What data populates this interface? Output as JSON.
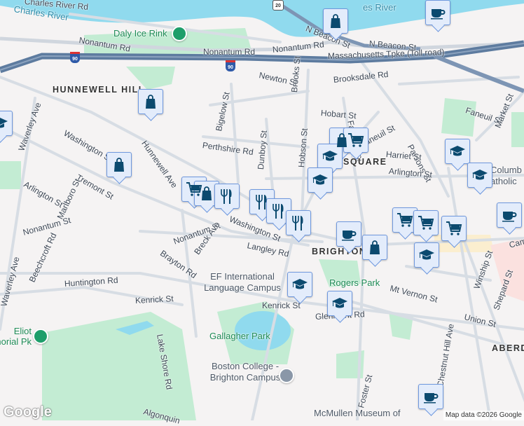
{
  "labels": {
    "charles_river_rd": "Charles River Rd",
    "charles_river": "Charles River",
    "charles_river_2": "es River",
    "daly_ice_rink": "Daly Ice Rink",
    "nonantum_rd_1": "Nonantum Rd",
    "nonantum_rd_2": "Nonantum Rd",
    "nonantum_rd_3": "Nonantum Rd",
    "n_beacon_1": "N Beacon St",
    "n_beacon_2": "N Beacon St",
    "mass_pike": "Massachusetts Tpke (Toll road)",
    "hunnewell_hill": "HUNNEWELL HILL",
    "newton_st": "Newton St",
    "brooks_st": "Brooks St",
    "brooksdale_rd": "Brooksdale Rd",
    "hobart_st": "Hobart St",
    "falkland_st": "Falkland St",
    "faneuil_st_1": "Faneuil St",
    "faneuil_st_2": "Faneuil St",
    "parsons_st": "Parsons St",
    "market_st": "Market St",
    "harriet_st": "Harriet St",
    "square": "SQUARE",
    "arlington_st_1": "Arlington St",
    "arlington_st_2": "Arlington St",
    "washington_st_1": "Washington St",
    "washington_st_2": "Washington St",
    "waverley_ave": "Waverley Ave",
    "tremont_st": "Tremont St",
    "marlboro_st": "Marlboro St",
    "hunnewell_ave": "Hunnewell Ave",
    "perthshire_rd": "Perthshire Rd",
    "bigelow_st": "Bigelow St",
    "dunboy_st": "Dunboy St",
    "hobson_st": "Hobson St",
    "nonantum_st_1": "Nonantum St",
    "nonantum_st_2": "Nonantum St",
    "breck_ave": "Breck Ave",
    "langley_rd": "Langley Rd",
    "brighton": "BRIGHTON",
    "brayton_rd": "Brayton Rd",
    "beechcroft_rd": "Beechcroft Rd",
    "huntington_rd": "Huntington Rd",
    "kenrick_st_1": "Kenrick St",
    "kenrick_st_2": "Kenrick St",
    "ef_campus": "EF International Language Campus",
    "rogers_park": "Rogers Park",
    "mt_vernon_st": "Mt Vernon St",
    "glenmont_rd": "Glenmont Rd",
    "lake_shore_rd": "Lake Shore Rd",
    "gallagher_park": "Gallagher Park",
    "eliot_pk": "Eliot Memorial Pk",
    "bc_campus": "Boston College - Brighton Campus",
    "foster_st": "Foster St",
    "chestnut_hill_ave": "Chestnut Hill Ave",
    "union_st": "Union St",
    "winship_st": "Winship St",
    "shepard_st": "Shepard St",
    "aberdeen": "ABERD",
    "mcmullen": "McMullen Museum of",
    "algonquin": "Algonquin",
    "columbkille": "Columb atholic",
    "cambridge": "Cam"
  },
  "shields": {
    "i90": "90",
    "us20": "20"
  },
  "markers": [
    {
      "type": "shopping-bag"
    },
    {
      "type": "coffee-cup"
    },
    {
      "type": "shopping-bag"
    },
    {
      "type": "shopping-bag"
    },
    {
      "type": "graduation-cap"
    },
    {
      "type": "shopping-cart"
    },
    {
      "type": "shopping-bag"
    },
    {
      "type": "restaurant"
    },
    {
      "type": "restaurant"
    },
    {
      "type": "restaurant"
    },
    {
      "type": "restaurant"
    },
    {
      "type": "shopping-bag"
    },
    {
      "type": "shopping-cart"
    },
    {
      "type": "graduation-cap"
    },
    {
      "type": "graduation-cap"
    },
    {
      "type": "graduation-cap"
    },
    {
      "type": "graduation-cap"
    },
    {
      "type": "coffee-cup"
    },
    {
      "type": "shopping-cart"
    },
    {
      "type": "shopping-cart"
    },
    {
      "type": "shopping-cart"
    },
    {
      "type": "graduation-cap"
    },
    {
      "type": "coffee-cup"
    },
    {
      "type": "shopping-bag"
    },
    {
      "type": "graduation-cap"
    },
    {
      "type": "graduation-cap"
    },
    {
      "type": "coffee-cup"
    }
  ],
  "attribution": "Map data ©2026 Google",
  "logo": "Google",
  "colors": {
    "marker_icon": "#0b4a6f",
    "marker_bg": "#e3ecfb",
    "water": "#90daee",
    "park": "#c3ecd3",
    "highway": "#6a86a8"
  }
}
